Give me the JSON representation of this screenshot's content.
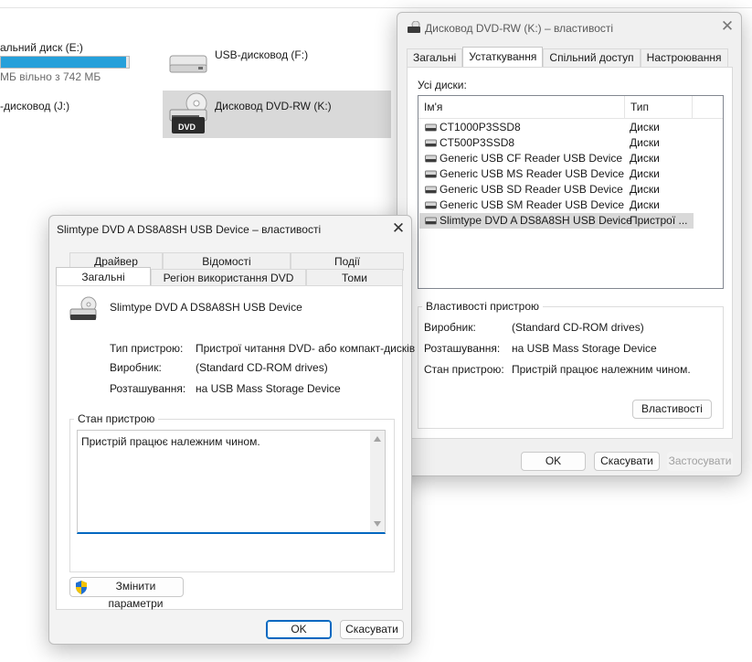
{
  "explorer": {
    "local_disk_label": "альний диск (E:)",
    "local_disk_free": "МБ вільно з 742 МБ",
    "local_disk_used_fraction": 0.98,
    "usb_drive_f": "USB-дисковод (F:)",
    "usb_drive_j": "-дисковод (J:)",
    "dvd_drive_k": "Дисковод DVD-RW (K:)",
    "dvd_badge": "DVD"
  },
  "dvd_props": {
    "title": "Дисковод DVD-RW (K:) – властивості",
    "tabs": [
      "Загальні",
      "Устаткування",
      "Спільний доступ",
      "Настроювання"
    ],
    "active_tab": "Устаткування",
    "all_disks_label": "Усі диски:",
    "columns": [
      "Ім'я",
      "Тип"
    ],
    "disks": [
      {
        "name": "CT1000P3SSD8",
        "type": "Диски"
      },
      {
        "name": "CT500P3SSD8",
        "type": "Диски"
      },
      {
        "name": "Generic USB CF Reader USB Device",
        "type": "Диски"
      },
      {
        "name": "Generic USB MS Reader USB Device",
        "type": "Диски"
      },
      {
        "name": "Generic USB SD Reader USB Device",
        "type": "Диски"
      },
      {
        "name": "Generic USB SM Reader USB Device",
        "type": "Диски"
      },
      {
        "name": "Slimtype DVD A  DS8A8SH USB Device",
        "type": "Пристрої ..."
      }
    ],
    "selected_index": 6,
    "device_props_title": "Властивості пристрою",
    "manufacturer_label": "Виробник:",
    "manufacturer_value": "(Standard CD-ROM drives)",
    "location_label": "Розташування:",
    "location_value": "на USB Mass Storage Device",
    "status_label": "Стан пристрою:",
    "status_value": "Пристрій працює належним чином.",
    "properties_button": "Властивості",
    "ok": "OK",
    "cancel": "Скасувати",
    "apply": "Застосувати"
  },
  "device_props": {
    "title": "Slimtype DVD A  DS8A8SH USB Device – властивості",
    "tabs_row1": [
      "Драйвер",
      "Відомості",
      "Події"
    ],
    "tabs_row2": [
      "Загальні",
      "Регіон використання DVD",
      "Томи"
    ],
    "active_tab": "Загальні",
    "device_name": "Slimtype DVD A  DS8A8SH USB Device",
    "type_label": "Тип пристрою:",
    "type_value": "Пристрої читання DVD- або компакт-дисків",
    "manufacturer_label": "Виробник:",
    "manufacturer_value": "(Standard CD-ROM drives)",
    "location_label": "Розташування:",
    "location_value": "на USB Mass Storage Device",
    "status_group_title": "Стан пристрою",
    "status_text": "Пристрій працює належним чином.",
    "change_settings_button": "Змінити параметри",
    "ok": "OK",
    "cancel": "Скасувати"
  },
  "colors": {
    "capacity_bar": "#26a0da",
    "accent": "#0067c0",
    "selection": "#d9d9d9"
  }
}
